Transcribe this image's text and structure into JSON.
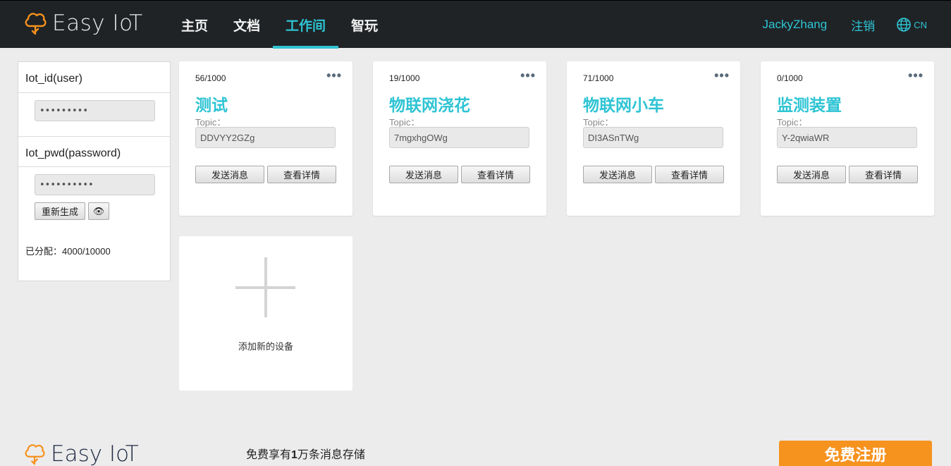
{
  "header": {
    "brand": "Easy IoT",
    "nav": [
      {
        "label": "主页",
        "active": false
      },
      {
        "label": "文档",
        "active": false
      },
      {
        "label": "工作间",
        "active": true
      },
      {
        "label": "智玩",
        "active": false
      }
    ],
    "username": "JackyZhang",
    "logout": "注销",
    "lang": "CN"
  },
  "sidebar": {
    "id_title": "Iot_id(user)",
    "id_value": "•••••••••",
    "pwd_title": "Iot_pwd(password)",
    "pwd_value": "••••••••••",
    "regen_label": "重新生成",
    "eye_icon": "👁",
    "allocated": "已分配：4000/10000"
  },
  "devices": [
    {
      "count": "56/1000",
      "name": "测试",
      "topic_label": "Topic：",
      "topic": "DDVYY2GZg",
      "send": "发送消息",
      "detail": "查看详情",
      "menu": "•••"
    },
    {
      "count": "19/1000",
      "name": "物联网浇花",
      "topic_label": "Topic：",
      "topic": "7mgxhgOWg",
      "send": "发送消息",
      "detail": "查看详情",
      "menu": "•••"
    },
    {
      "count": "71/1000",
      "name": "物联网小车",
      "topic_label": "Topic：",
      "topic": "DI3ASnTWg",
      "send": "发送消息",
      "detail": "查看详情",
      "menu": "•••"
    },
    {
      "count": "0/1000",
      "name": "监测装置",
      "topic_label": "Topic：",
      "topic": "Y-2qwiaWR",
      "send": "发送消息",
      "detail": "查看详情",
      "menu": "•••"
    }
  ],
  "add_device": {
    "label": "添加新的设备"
  },
  "footer": {
    "brand": "Easy IoT",
    "promo_before": "免费享有",
    "promo_bold": "1",
    "promo_after": "万条消息存储",
    "register": "免费注册"
  },
  "colors": {
    "accent": "#2ec4d4",
    "header_bg": "#1f2326",
    "cta": "#f6921e",
    "logo": "#f6921e"
  }
}
